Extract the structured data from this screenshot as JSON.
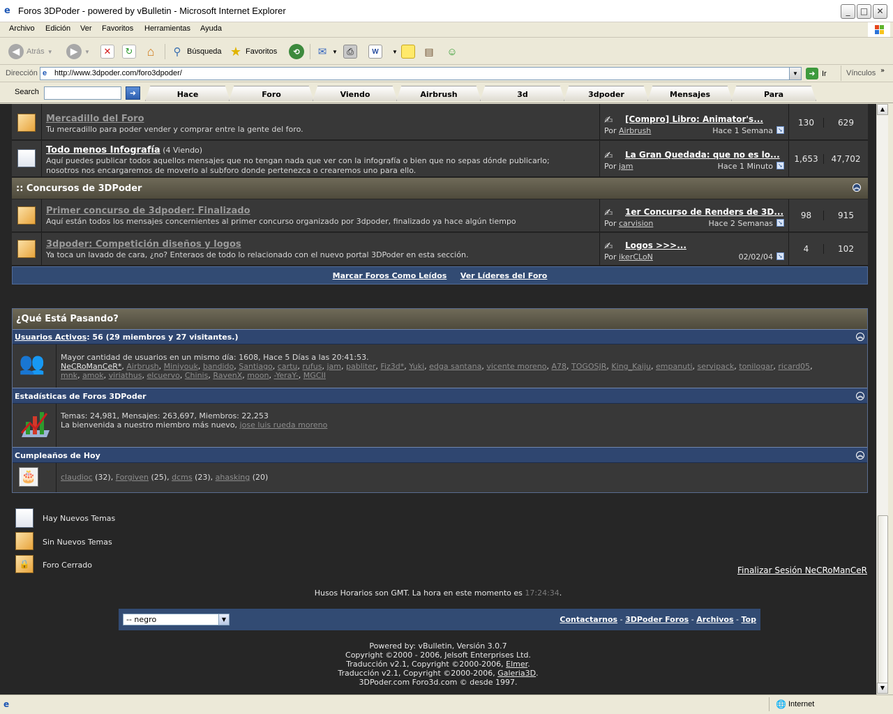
{
  "window": {
    "title": "Foros 3DPoder - powered by vBulletin - Microsoft Internet Explorer"
  },
  "menu": [
    "Archivo",
    "Edición",
    "Ver",
    "Favoritos",
    "Herramientas",
    "Ayuda"
  ],
  "toolbar": {
    "back": "Atrás",
    "search": "Búsqueda",
    "favorites": "Favoritos"
  },
  "address": {
    "label": "Dirección",
    "url": "http://www.3dpoder.com/foro3dpoder/",
    "go": "Ir",
    "links": "Vínculos"
  },
  "searchbar": {
    "label": "Search",
    "tabs": [
      "Hace",
      "Foro",
      "Viendo",
      "Airbrush",
      "3d",
      "3dpoder",
      "Mensajes",
      "Para"
    ]
  },
  "forums": [
    {
      "title": "Mercadillo del Foro",
      "viewing": "",
      "desc": "Tu mercadillo para poder vender y comprar entre la gente del foro.",
      "desc2": "",
      "lp_title": "[Compro] Libro: Animator's...",
      "lp_by": "Por",
      "lp_user": "Airbrush",
      "lp_time": "Hace 1 Semana",
      "threads": "130",
      "posts": "629",
      "unread": false
    },
    {
      "title": "Todo menos Infografía",
      "viewing": "(4 Viendo)",
      "desc": "Aquí puedes publicar todos aquellos mensajes que no tengan nada que ver con la infografía o bien que no sepas dónde publicarlo;",
      "desc2": "nosotros nos encargaremos de moverlo al subforo donde pertenezca o crearemos uno para ello.",
      "lp_title": "La Gran Quedada: que no es lo...",
      "lp_by": "Por",
      "lp_user": "jam",
      "lp_time": "Hace 1 Minuto",
      "threads": "1,653",
      "posts": "47,702",
      "unread": true
    }
  ],
  "category": {
    "title": ":: Concursos de 3DPoder"
  },
  "contests": [
    {
      "title": "Primer concurso de 3dpoder: Finalizado",
      "desc": "Aquí están todos los mensajes concernientes al primer concurso organizado por 3dpoder, finalizado ya hace algún tiempo",
      "lp_title": "1er Concurso de Renders de 3D...",
      "lp_by": "Por",
      "lp_user": "carvision",
      "lp_time": "Hace 2 Semanas",
      "threads": "98",
      "posts": "915"
    },
    {
      "title": "3dpoder: Competición diseños y logos",
      "desc": "Ya toca un lavado de cara, ¿no? Enteraos de todo lo relacionado con el nuevo portal 3DPoder en esta sección.",
      "lp_title": "Logos >>>...",
      "lp_by": "Por",
      "lp_user": "ikerCLoN",
      "lp_time": "02/02/04",
      "threads": "4",
      "posts": "102"
    }
  ],
  "forum_links": {
    "mark_read": "Marcar Foros Como Leídos",
    "leaders": "Ver Líderes del Foro"
  },
  "whats_going_on": {
    "title": "¿Qué Está Pasando?",
    "active_label": "Usuarios Activos",
    "active_count": ": 56 (29 miembros y 27 visitantes.)",
    "max_users": "Mayor cantidad de usuarios en un mismo día: 1608, Hace 5 Días a las 20:41:53.",
    "users_line1": [
      "NeCRoManCeR*",
      "Airbrush",
      "Miniyouk",
      "bandido",
      "Santiago",
      "cartu",
      "rufus",
      "jam",
      "pabliter",
      "Fiz3d*",
      "Yuki",
      "edga santana",
      "vicente moreno",
      "A78",
      "TOGOSJR",
      "King_Kaiju",
      "empanuti",
      "servipack",
      "tonilogar",
      "ricard05"
    ],
    "users_line2": [
      "mnk",
      "amok",
      "viriathus",
      "elcuervo",
      "Chinis",
      "RavenX",
      "moon",
      "-YeraY-",
      "MGCII"
    ],
    "stats_title": "Estadísticas de Foros 3DPoder",
    "stats_line": "Temas: 24,981, Mensajes: 263,697, Miembros: 22,253",
    "welcome": "La bienvenida a nuestro miembro más nuevo,",
    "newest": "jose luis rueda moreno",
    "bday_title": "Cumpleaños de Hoy",
    "bdays": [
      {
        "name": "claudioc",
        "age": "(32)"
      },
      {
        "name": "Forgiven",
        "age": "(25)"
      },
      {
        "name": "dcms",
        "age": "(23)"
      },
      {
        "name": "ahasking",
        "age": "(20)"
      }
    ]
  },
  "legend": {
    "new": "Hay Nuevos Temas",
    "none": "Sin Nuevos Temas",
    "closed": "Foro Cerrado"
  },
  "logout": "Finalizar Sesión NeCRoManCeR",
  "timezone": {
    "text": "Husos Horarios son GMT. La hora en este momento es",
    "time": "17:24:34",
    "dot": "."
  },
  "footer": {
    "style_select": "-- negro",
    "contact": "Contactarnos",
    "forums": "3DPoder Foros",
    "archives": "Archivos",
    "top": "Top"
  },
  "copyright": {
    "powered": "Powered by: vBulletin, Versión 3.0.7",
    "copy": "Copyright ©2000 - 2006, Jelsoft Enterprises Ltd.",
    "trad1_pre": "Traducción v2.1, Copyright ©2000-2006,",
    "trad1_link": "Elmer",
    "trad2_pre": "Traducción v2.1, Copyright ©2000-2006,",
    "trad2_link": "Galeria3D",
    "since": "3DPoder.com Foro3d.com © desde 1997."
  },
  "status": {
    "zone": "Internet"
  }
}
